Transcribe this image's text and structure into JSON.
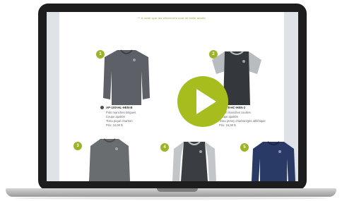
{
  "page": {
    "note": "** A noter que les vêtements sont de taille adulte"
  },
  "products": [
    {
      "number": "1",
      "code": "AP-100-HL-HEN-B",
      "lines": [
        "Polo manches longues",
        "Coupe ajustée",
        "Tissu piqué charbon",
        "Prix: 24,00 $"
      ],
      "color": "#5d6066",
      "sleeve_color": "#5d6066",
      "long_sleeve": true
    },
    {
      "number": "2",
      "code": "AP-178-HC-HEN-2",
      "lines": [
        "T-shirt manches courtes",
        "Coupe ajustée",
        "Tissu jersey charbon/gris athlétique",
        "Prix: 16,00 $"
      ],
      "color": "#34373c",
      "sleeve_color": "#b9bcbf",
      "long_sleeve": false
    },
    {
      "number": "3",
      "code": "",
      "lines": [],
      "color": "#6a6d70",
      "sleeve_color": "#6a6d70",
      "long_sleeve": true
    },
    {
      "number": "4",
      "code": "",
      "lines": [],
      "color": "#3a3d42",
      "sleeve_color": "#c3c6c9",
      "long_sleeve": true
    },
    {
      "number": "5",
      "code": "",
      "lines": [],
      "color": "#2a3a66",
      "sleeve_color": "#2a3a66",
      "long_sleeve": true
    }
  ],
  "colors": {
    "accent": "#a7bd1d",
    "laptop_bezel": "#1d1d1d"
  },
  "icons": {
    "play": "play-icon",
    "swatch": "color-swatch-icon"
  }
}
